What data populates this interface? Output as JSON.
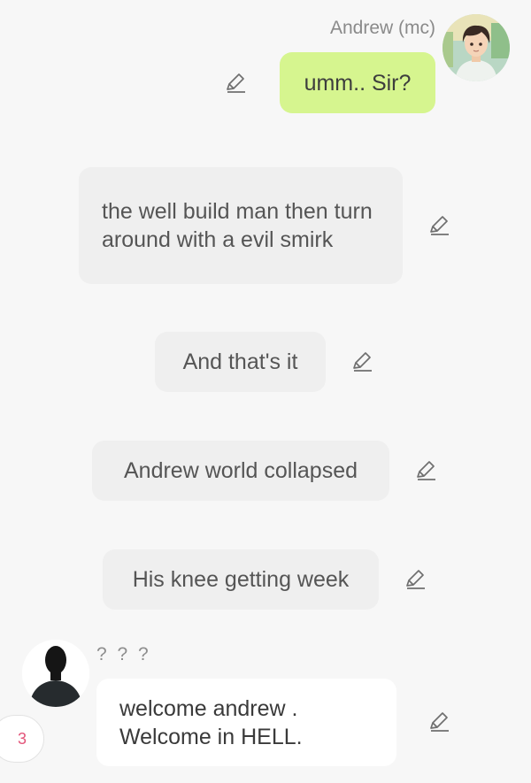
{
  "header": {
    "sender_name": "Andrew (mc)"
  },
  "messages": [
    {
      "speaker": "Andrew (mc)",
      "type": "mc",
      "text": "umm.. Sir?",
      "bubble_color": "#d6f58f"
    },
    {
      "type": "narration",
      "text": "the well build man then turn around with a evil smirk"
    },
    {
      "type": "narration",
      "text": "And that's it"
    },
    {
      "type": "narration",
      "text": "Andrew world collapsed"
    },
    {
      "type": "narration",
      "text": "His knee getting week"
    },
    {
      "speaker": "? ? ?",
      "type": "character",
      "text": "welcome andrew . Welcome in HELL."
    }
  ],
  "unknown_speaker": {
    "name": "? ? ?"
  },
  "page_badge": {
    "value": "3",
    "color": "#e3557a"
  },
  "icons": {
    "edit": "pencil-icon",
    "mc_avatar": "anime-boy-avatar",
    "unknown_avatar": "silhouette-avatar"
  }
}
